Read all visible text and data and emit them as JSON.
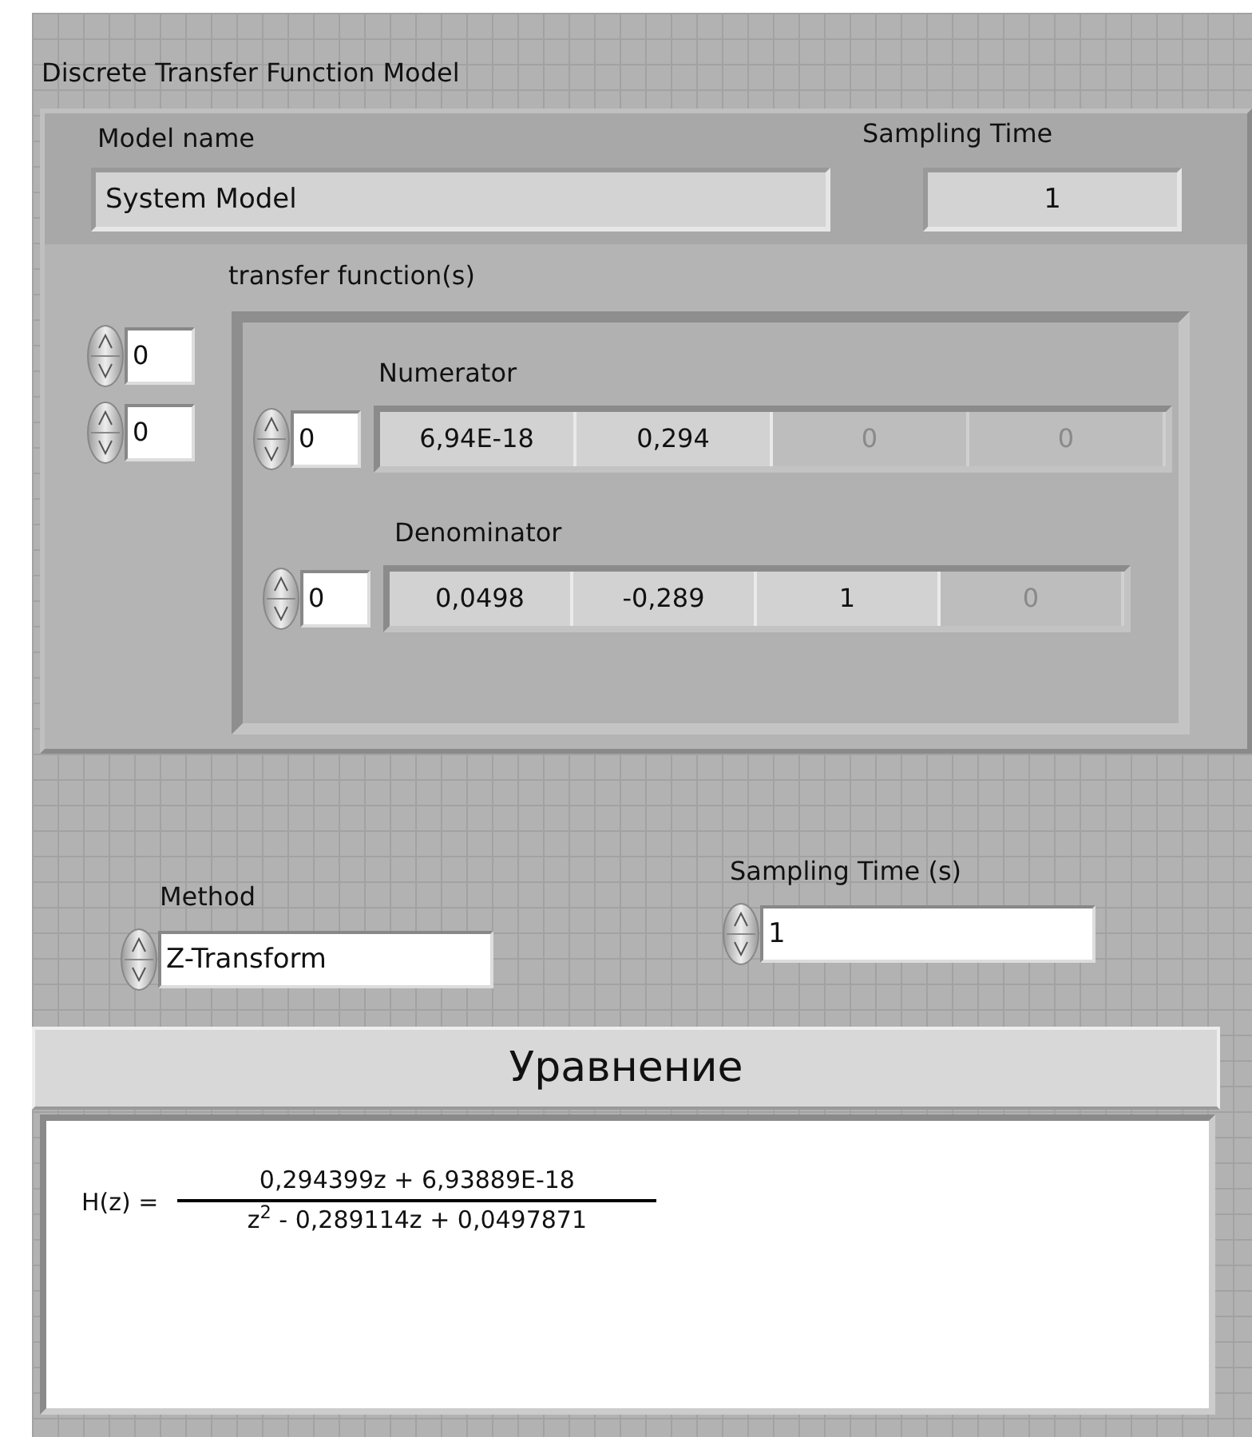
{
  "title": "Discrete Transfer Function Model",
  "model": {
    "name_label": "Model name",
    "name_value": "System Model",
    "sampling_label": "Sampling Time",
    "sampling_value": "1"
  },
  "transfer_functions": {
    "label": "transfer function(s)",
    "indices": [
      "0",
      "0"
    ],
    "arrays": [
      {
        "label": "Numerator",
        "index": "0",
        "cells": [
          {
            "value": "6,94E-18",
            "dimmed": false
          },
          {
            "value": "0,294",
            "dimmed": false
          },
          {
            "value": "0",
            "dimmed": true
          },
          {
            "value": "0",
            "dimmed": true
          }
        ]
      },
      {
        "label": "Denominator",
        "index": "0",
        "cells": [
          {
            "value": "0,0498",
            "dimmed": false
          },
          {
            "value": "-0,289",
            "dimmed": false
          },
          {
            "value": "1",
            "dimmed": false
          },
          {
            "value": "0",
            "dimmed": true
          }
        ]
      }
    ]
  },
  "method": {
    "label": "Method",
    "value": "Z-Transform"
  },
  "sampling_time": {
    "label": "Sampling Time (s)",
    "value": "1"
  },
  "equation": {
    "title": "Уравнение",
    "lhs": "H(z) =",
    "numerator": "0,294399z + 6,93889E-18",
    "denominator": "z$^{2}$ - 0,289114z + 0,0497871"
  }
}
